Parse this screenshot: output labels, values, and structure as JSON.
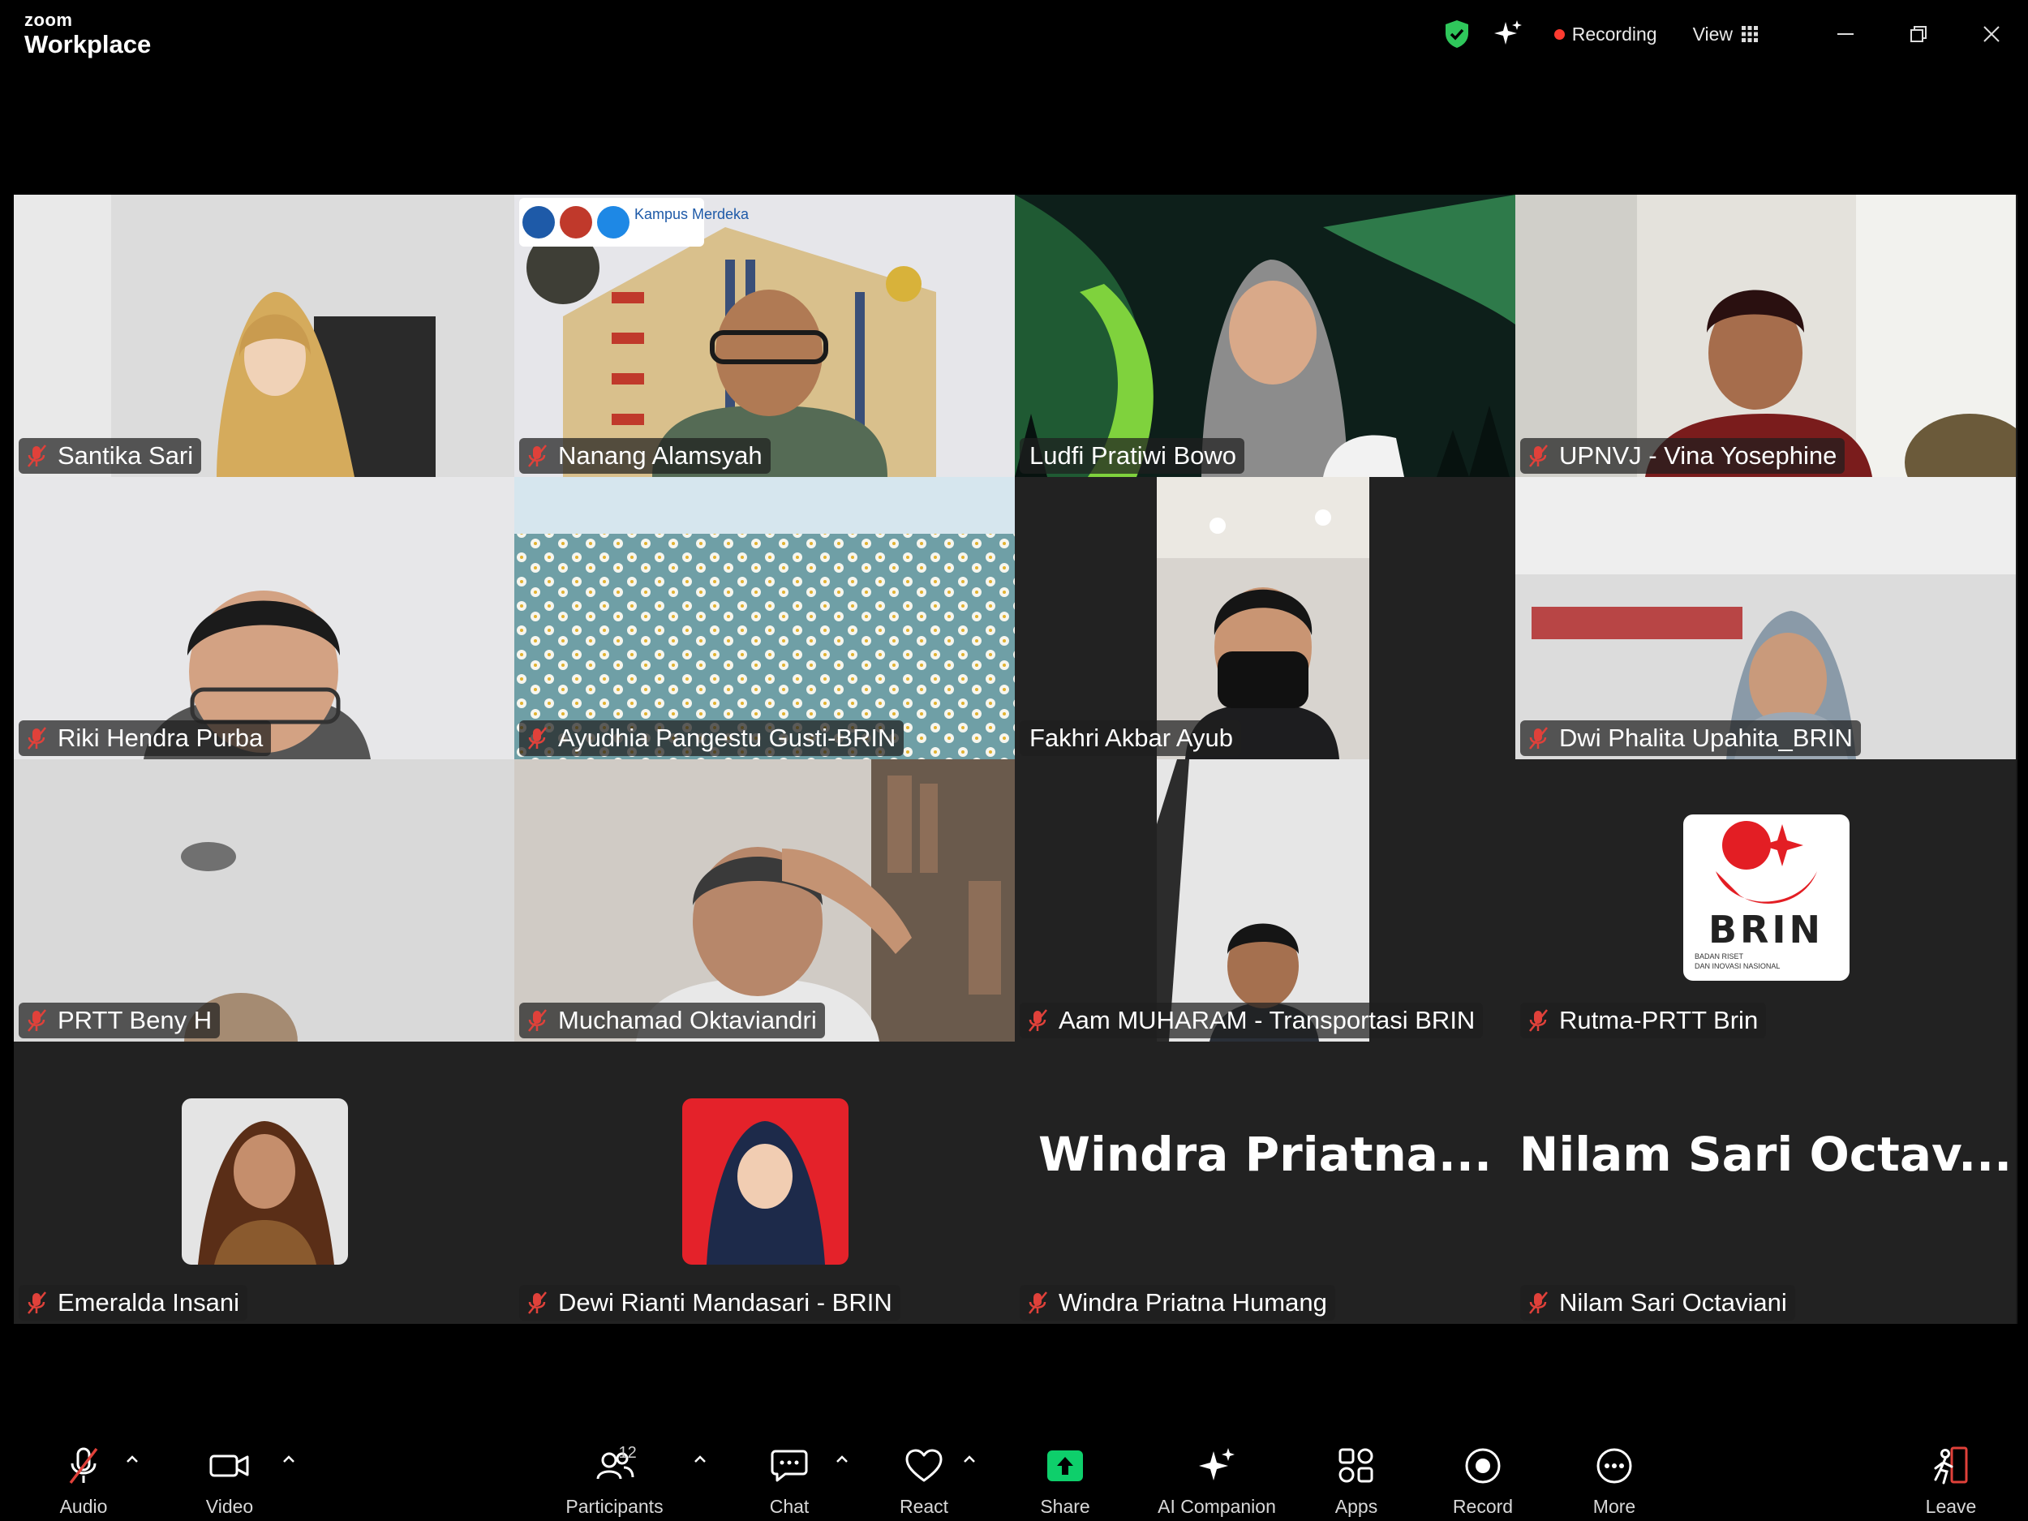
{
  "app": {
    "brand": "zoom",
    "product": "Workplace"
  },
  "titlebar": {
    "recording_label": "Recording",
    "view_label": "View"
  },
  "participants": [
    {
      "name": "Santika Sari",
      "muted": true
    },
    {
      "name": "Nanang Alamsyah",
      "muted": true
    },
    {
      "name": "Ludfi Pratiwi Bowo",
      "muted": false,
      "active_speaker": true
    },
    {
      "name": "UPNVJ - Vina Yosephine",
      "muted": true
    },
    {
      "name": "Riki Hendra Purba",
      "muted": true
    },
    {
      "name": "Ayudhia Pangestu Gusti-BRIN",
      "muted": true
    },
    {
      "name": "Fakhri Akbar Ayub",
      "muted": false
    },
    {
      "name": "Dwi Phalita Upahita_BRIN",
      "muted": true
    },
    {
      "name": "PRTT Beny H",
      "muted": true
    },
    {
      "name": "Muchamad Oktaviandri",
      "muted": true
    },
    {
      "name": "Aam MUHARAM - Transportasi BRIN",
      "muted": true
    },
    {
      "name": "Rutma-PRTT Brin",
      "muted": true
    },
    {
      "name": "Emeralda Insani",
      "muted": true
    },
    {
      "name": "Dewi Rianti Mandasari - BRIN",
      "muted": true
    },
    {
      "name": "Windra Priatna Humang",
      "muted": true,
      "display_text": "Windra  Priatna..."
    },
    {
      "name": "Nilam Sari Octaviani",
      "muted": true,
      "display_text": "Nilam  Sari  Octav..."
    }
  ],
  "overlay_text": {
    "building_banner": "Kampus Merdeka",
    "brin_logo": "BRIN",
    "brin_sub1": "BADAN RISET",
    "brin_sub2": "DAN INOVASI NASIONAL"
  },
  "toolbar": {
    "audio": "Audio",
    "video": "Video",
    "participants": "Participants",
    "participants_count": "12",
    "chat": "Chat",
    "react": "React",
    "share": "Share",
    "ai_companion": "AI Companion",
    "apps": "Apps",
    "record": "Record",
    "more": "More",
    "leave": "Leave"
  },
  "colors": {
    "active_speaker_border": "#21d07a",
    "share_green": "#0ecf6b",
    "mute_red": "#e0413a",
    "leave_red": "#e0413a",
    "recording_dot": "#ff3b30"
  }
}
